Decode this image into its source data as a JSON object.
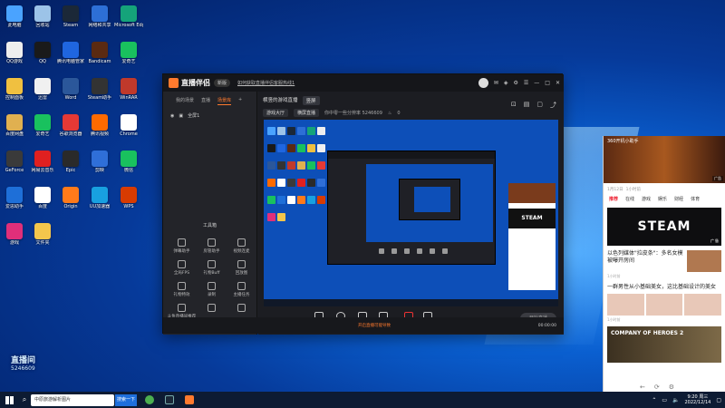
{
  "desktop": {
    "icons": [
      {
        "label": "此电脑",
        "color": "#4aa3ff"
      },
      {
        "label": "回收站",
        "color": "#9cc3e8"
      },
      {
        "label": "Steam",
        "color": "#1b2838"
      },
      {
        "label": "网络和共享",
        "color": "#2d6fd6"
      },
      {
        "label": "Microsoft Edge",
        "color": "#15a37a"
      },
      {
        "label": "QQ游戏",
        "color": "#eeeeee"
      },
      {
        "label": "QQ",
        "color": "#1a1a1a"
      },
      {
        "label": "腾讯电脑管家",
        "color": "#1f66e0"
      },
      {
        "label": "Bandicam",
        "color": "#5a2a12"
      },
      {
        "label": "爱奇艺",
        "color": "#19c15e"
      },
      {
        "label": "控制面板",
        "color": "#f0c040"
      },
      {
        "label": "迅雷",
        "color": "#f0f0f0"
      },
      {
        "label": "Word",
        "color": "#2b579a"
      },
      {
        "label": "Steam助手",
        "color": "#333333"
      },
      {
        "label": "WinRAR",
        "color": "#c0392b"
      },
      {
        "label": "百度网盘",
        "color": "#e0b050"
      },
      {
        "label": "爱奇艺",
        "color": "#19c15e"
      },
      {
        "label": "谷歌浏览器",
        "color": "#e53935"
      },
      {
        "label": "腾讯视频",
        "color": "#ff6a00"
      },
      {
        "label": "Chrome",
        "color": "#ffffff"
      },
      {
        "label": "GeForce",
        "color": "#3a3a3a"
      },
      {
        "label": "网易云音乐",
        "color": "#e02020"
      },
      {
        "label": "Epic",
        "color": "#2a2a2a"
      },
      {
        "label": "剪映",
        "color": "#2f6fd8"
      },
      {
        "label": "微信",
        "color": "#19c15e"
      },
      {
        "label": "爱思助手",
        "color": "#1e6fd8"
      },
      {
        "label": "百度",
        "color": "#ffffff"
      },
      {
        "label": "Origin",
        "color": "#ff7a1a"
      },
      {
        "label": "UU加速器",
        "color": "#18a0e0"
      },
      {
        "label": "WPS",
        "color": "#d83b01"
      },
      {
        "label": "游戏",
        "color": "#e02f7a"
      },
      {
        "label": "文件夹",
        "color": "#f3c64c"
      }
    ]
  },
  "watermark": {
    "name": "直播间",
    "number": "5246609"
  },
  "app": {
    "title": "直播伴侣",
    "version": "新版",
    "notice": "如何获取直播伴侣客服热线1",
    "left_tabs": [
      "我的场景",
      "直播",
      "场景库"
    ],
    "scene": "全屏1",
    "tools_title": "工具箱",
    "tools": [
      "弹幕助手",
      "房管助手",
      "视频连麦",
      "全局FPS",
      "礼物Buff",
      "回放图",
      "礼物特效",
      "录制",
      "主播任务",
      "斗鱼直播间推荐",
      "",
      ""
    ],
    "main_tabs": [
      "横竖的游戏直播",
      "竖屏"
    ],
    "room_row": {
      "category": "游戏大厅",
      "mode": "横屏直播",
      "id": "你中零一些分辨率 5246609",
      "fans": "0"
    },
    "sources": [
      "直播屏幕",
      "摄像头",
      "手机投屏",
      "多媒体",
      "麦克风",
      "扬声器"
    ],
    "start_live": "开始直播",
    "status": {
      "warn": "开启直播可能导致",
      "timer": "00:00:00"
    }
  },
  "ad_panel": {
    "banner_text": "360开机小助手",
    "banner_tag": "广告",
    "meta": [
      "1月12日",
      "1小时前"
    ],
    "tabs": [
      "推荐",
      "在线",
      "游戏",
      "娱乐",
      "财经",
      "体育"
    ],
    "steam_card": "STEAM",
    "steam_tag": "广告",
    "news1": "以色列媒体\"拉皮条\"：多名女模被曝开房间",
    "news1_meta": "1小时前",
    "news2": "一群男性从小基础美女，这比基础设计的美女",
    "news2_meta": "1小时前",
    "coh_title": "COMPANY OF HEROES 2",
    "footer": [
      "←",
      "⟳",
      "⚙"
    ]
  },
  "taskbar": {
    "search_text": "中原旅游解析图片",
    "search_button": "搜索一下",
    "tray_time": "9:20 周三",
    "tray_date": "2022/12/14"
  }
}
